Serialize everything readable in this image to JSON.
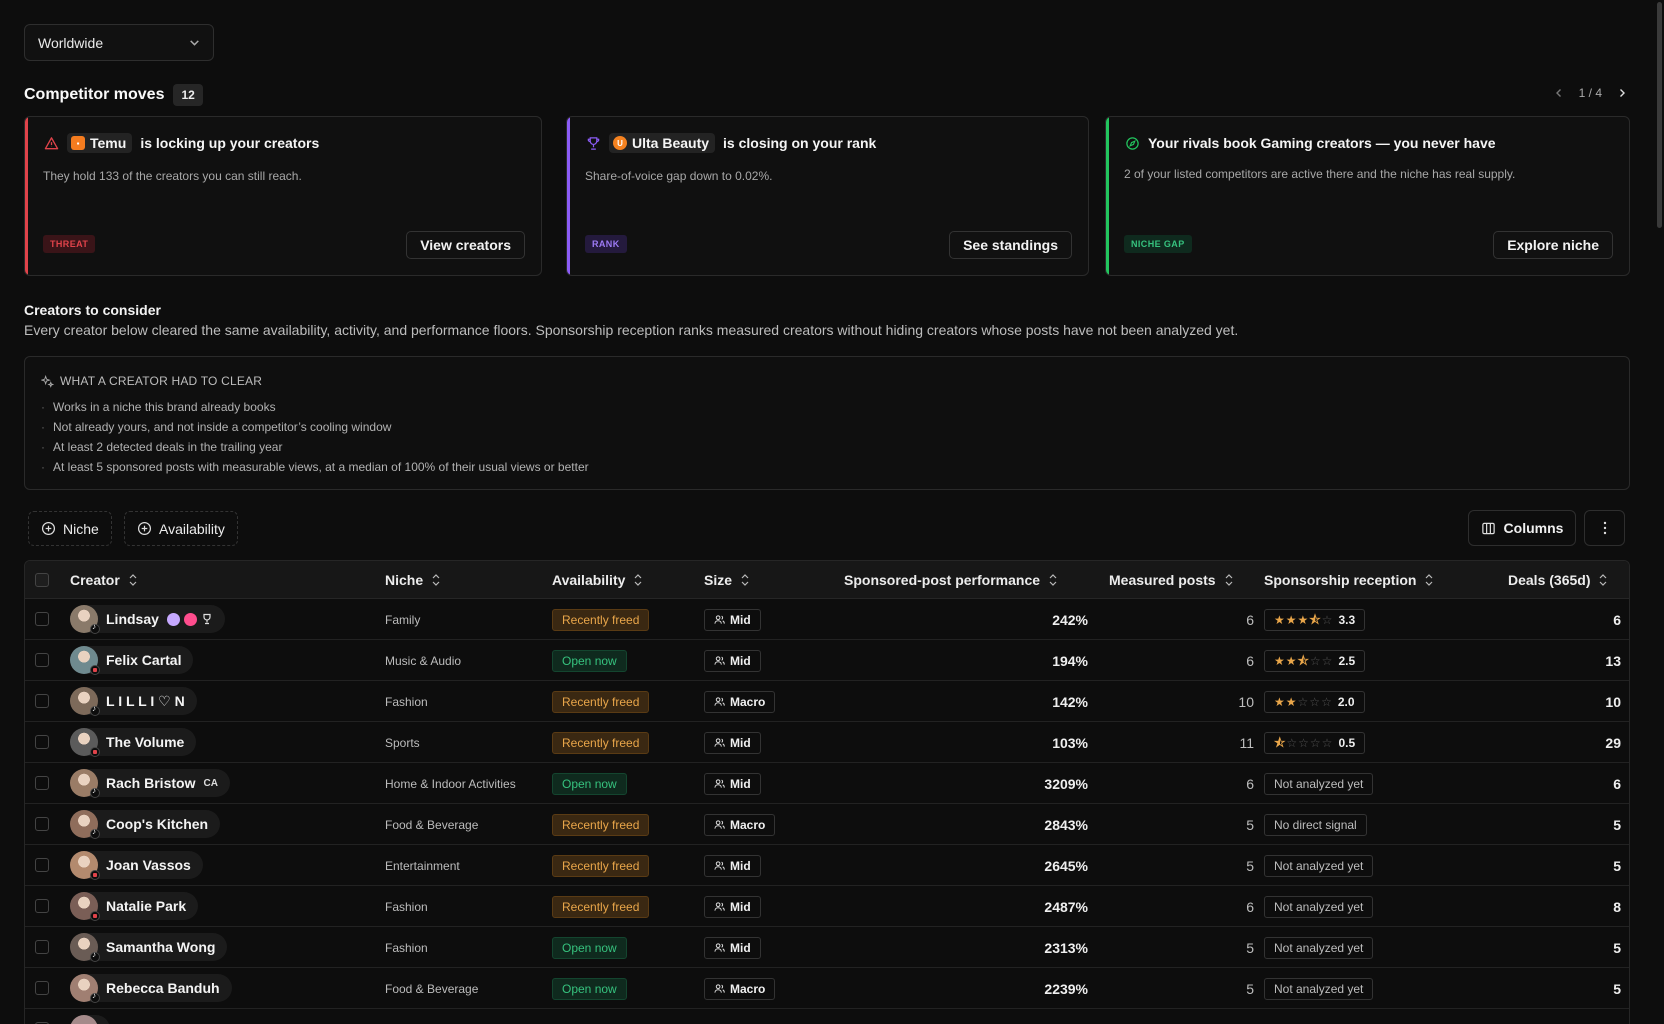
{
  "region": {
    "value": "Worldwide"
  },
  "competitor_moves": {
    "title": "Competitor moves",
    "count": "12",
    "pager": "1 / 4",
    "cards": [
      {
        "brand": "Temu",
        "headline": "is locking up your creators",
        "desc": "They hold 133 of the creators you can still reach.",
        "tag": "THREAT",
        "button": "View creators",
        "accent": "#e0434a",
        "icon": "alert-triangle-icon"
      },
      {
        "brand": "Ulta Beauty",
        "headline": "is closing on your rank",
        "desc": "Share-of-voice gap down to 0.02%.",
        "tag": "RANK",
        "button": "See standings",
        "accent": "#8b5cf6",
        "icon": "trophy-icon"
      },
      {
        "brand": "",
        "headline": "Your rivals book Gaming creators — you never have",
        "desc": "2 of your listed competitors are active there and the niche has real supply.",
        "tag": "NICHE GAP",
        "button": "Explore niche",
        "accent": "#22c55e",
        "icon": "compass-icon"
      }
    ]
  },
  "creators_section": {
    "title": "Creators to consider",
    "desc": "Every creator below cleared the same availability, activity, and performance floors. Sponsorship reception ranks measured creators without hiding creators whose posts have not been analyzed yet.",
    "criteria_title": "WHAT A CREATOR HAD TO CLEAR",
    "criteria": [
      "Works in a niche this brand already books",
      "Not already yours, and not inside a competitor’s cooling window",
      "At least 2 detected deals in the trailing year",
      "At least 5 sponsored posts with measurable views, at a median of 100% of their usual views or better"
    ]
  },
  "filters": {
    "niche": "Niche",
    "availability": "Availability",
    "columns": "Columns"
  },
  "table": {
    "headers": {
      "creator": "Creator",
      "niche": "Niche",
      "availability": "Availability",
      "size": "Size",
      "performance": "Sponsored-post performance",
      "measured": "Measured posts",
      "reception": "Sponsorship reception",
      "deals": "Deals (365d)"
    },
    "rows": [
      {
        "name": "Lindsay",
        "extra": "",
        "niche": "Family",
        "availability": "Recently freed",
        "size": "Mid",
        "performance": "242%",
        "measured": "6",
        "rating": 3.3,
        "rating_label": "3.3",
        "reception_text": "",
        "deals": "6"
      },
      {
        "name": "Felix Cartal",
        "extra": "",
        "niche": "Music & Audio",
        "availability": "Open now",
        "size": "Mid",
        "performance": "194%",
        "measured": "6",
        "rating": 2.5,
        "rating_label": "2.5",
        "reception_text": "",
        "deals": "13"
      },
      {
        "name": "L I L L I ♡ N",
        "extra": "",
        "niche": "Fashion",
        "availability": "Recently freed",
        "size": "Macro",
        "performance": "142%",
        "measured": "10",
        "rating": 2.0,
        "rating_label": "2.0",
        "reception_text": "",
        "deals": "10"
      },
      {
        "name": "The Volume",
        "extra": "",
        "niche": "Sports",
        "availability": "Recently freed",
        "size": "Mid",
        "performance": "103%",
        "measured": "11",
        "rating": 0.5,
        "rating_label": "0.5",
        "reception_text": "",
        "deals": "29"
      },
      {
        "name": "Rach Bristow",
        "extra": "CA",
        "niche": "Home & Indoor Activities",
        "availability": "Open now",
        "size": "Mid",
        "performance": "3209%",
        "measured": "6",
        "rating": null,
        "rating_label": "",
        "reception_text": "Not analyzed yet",
        "deals": "6"
      },
      {
        "name": "Coop's Kitchen",
        "extra": "",
        "niche": "Food & Beverage",
        "availability": "Recently freed",
        "size": "Macro",
        "performance": "2843%",
        "measured": "5",
        "rating": null,
        "rating_label": "",
        "reception_text": "No direct signal",
        "deals": "5"
      },
      {
        "name": "Joan Vassos",
        "extra": "",
        "niche": "Entertainment",
        "availability": "Recently freed",
        "size": "Mid",
        "performance": "2645%",
        "measured": "5",
        "rating": null,
        "rating_label": "",
        "reception_text": "Not analyzed yet",
        "deals": "5"
      },
      {
        "name": "Natalie Park",
        "extra": "",
        "niche": "Fashion",
        "availability": "Recently freed",
        "size": "Mid",
        "performance": "2487%",
        "measured": "6",
        "rating": null,
        "rating_label": "",
        "reception_text": "Not analyzed yet",
        "deals": "8"
      },
      {
        "name": "Samantha Wong",
        "extra": "",
        "niche": "Fashion",
        "availability": "Open now",
        "size": "Mid",
        "performance": "2313%",
        "measured": "5",
        "rating": null,
        "rating_label": "",
        "reception_text": "Not analyzed yet",
        "deals": "5"
      },
      {
        "name": "Rebecca Banduh",
        "extra": "",
        "niche": "Food & Beverage",
        "availability": "Open now",
        "size": "Macro",
        "performance": "2239%",
        "measured": "5",
        "rating": null,
        "rating_label": "",
        "reception_text": "Not analyzed yet",
        "deals": "5"
      }
    ]
  }
}
